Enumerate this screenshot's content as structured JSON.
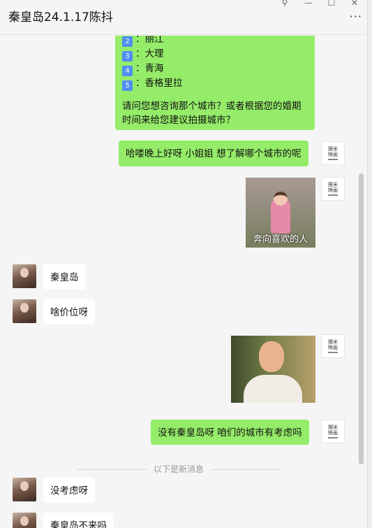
{
  "window": {
    "title": "秦皇岛24.1.17陈抖",
    "controls": {
      "pin": "⚲",
      "minimize": "—",
      "maximize": "☐",
      "close": "✕"
    },
    "more": "···"
  },
  "messages": {
    "m1": {
      "lines": [
        {
          "num": "2",
          "text": "：丽江"
        },
        {
          "num": "3",
          "text": "：大理"
        },
        {
          "num": "4",
          "text": "：青海"
        },
        {
          "num": "5",
          "text": "：香格里拉"
        }
      ],
      "question_line1": "请问您想咨询那个城市？或者根据您的婚期",
      "question_line2": "时间来给您建议拍摄城市？"
    },
    "m2": "哈喽晚上好呀 小姐姐 想了解哪个城市的呢",
    "m3_caption": "奔向喜欢的人",
    "m4": "秦皇岛",
    "m5": "啥价位呀",
    "m7": "没有秦皇岛呀 咱们的城市有考虑吗",
    "new_divider": "以下是新消息",
    "m8": "没考虑呀",
    "m9": "秦皇岛不来吗"
  },
  "store_avatar": {
    "line1": "摆米",
    "line2": "映画"
  },
  "colors": {
    "outgoing": "#95ec69",
    "incoming": "#ffffff",
    "background": "#f5f5f5"
  }
}
